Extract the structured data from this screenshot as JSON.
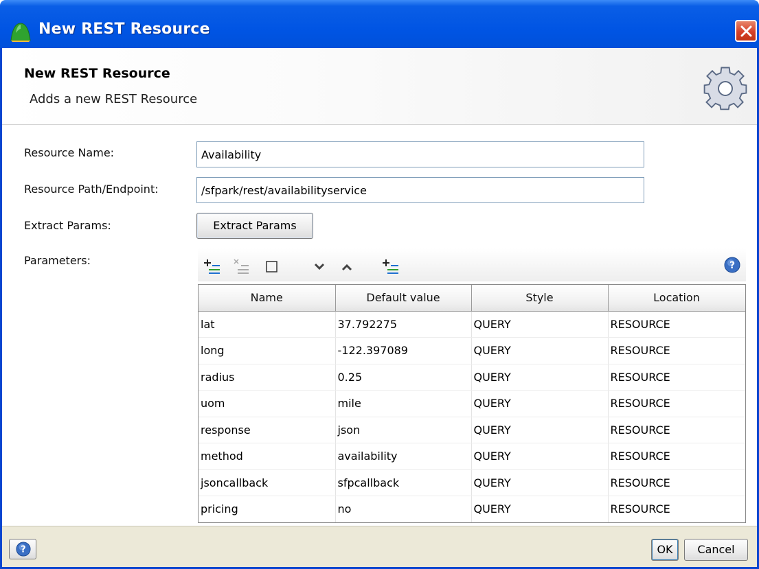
{
  "window": {
    "title": "New REST Resource",
    "accent_color": "#0054e3",
    "close_color": "#d6412a"
  },
  "banner": {
    "title": "New REST Resource",
    "subtitle": "Adds a new REST Resource",
    "icon": "gear-icon"
  },
  "form": {
    "resource_name_label": "Resource Name:",
    "resource_name_value": "Availability",
    "resource_path_label": "Resource Path/Endpoint:",
    "resource_path_value": "/sfpark/rest/availabilityservice",
    "extract_params_label": "Extract Params:",
    "extract_params_button": "Extract Params",
    "parameters_label": "Parameters:"
  },
  "toolbar": {
    "icons": [
      "add-param-icon",
      "remove-param-icon",
      "clear-icon",
      "move-down-icon",
      "move-up-icon",
      "add-param-alt-icon",
      "help-icon"
    ]
  },
  "table": {
    "columns": [
      "Name",
      "Default value",
      "Style",
      "Location"
    ],
    "rows": [
      [
        "lat",
        "37.792275",
        "QUERY",
        "RESOURCE"
      ],
      [
        "long",
        "-122.397089",
        "QUERY",
        "RESOURCE"
      ],
      [
        "radius",
        "0.25",
        "QUERY",
        "RESOURCE"
      ],
      [
        "uom",
        "mile",
        "QUERY",
        "RESOURCE"
      ],
      [
        "response",
        "json",
        "QUERY",
        "RESOURCE"
      ],
      [
        "method",
        "availability",
        "QUERY",
        "RESOURCE"
      ],
      [
        "jsoncallback",
        "sfpcallback",
        "QUERY",
        "RESOURCE"
      ],
      [
        "pricing",
        "no",
        "QUERY",
        "RESOURCE"
      ]
    ]
  },
  "footer": {
    "ok_label": "OK",
    "cancel_label": "Cancel"
  }
}
